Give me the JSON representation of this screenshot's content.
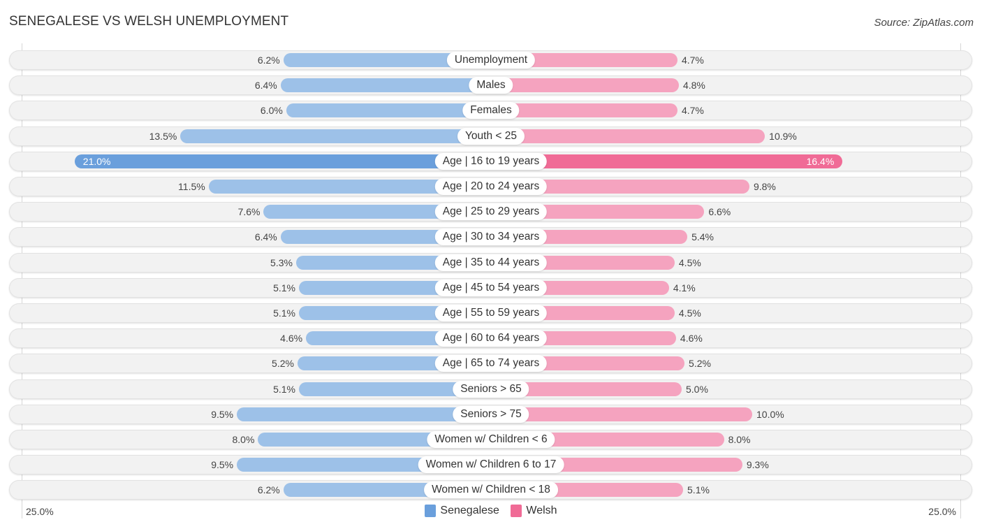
{
  "chart_data": {
    "type": "bar",
    "orientation": "diverging-horizontal",
    "title": "SENEGALESE VS WELSH UNEMPLOYMENT",
    "source": "Source: ZipAtlas.com",
    "categories": [
      "Unemployment",
      "Males",
      "Females",
      "Youth < 25",
      "Age | 16 to 19 years",
      "Age | 20 to 24 years",
      "Age | 25 to 29 years",
      "Age | 30 to 34 years",
      "Age | 35 to 44 years",
      "Age | 45 to 54 years",
      "Age | 55 to 59 years",
      "Age | 60 to 64 years",
      "Age | 65 to 74 years",
      "Seniors > 65",
      "Seniors > 75",
      "Women w/ Children < 6",
      "Women w/ Children 6 to 17",
      "Women w/ Children < 18"
    ],
    "series": [
      {
        "name": "Senegalese",
        "color": "#6a9fdc",
        "light_color": "#9dc1e8",
        "values": [
          6.2,
          6.4,
          6.0,
          13.5,
          21.0,
          11.5,
          7.6,
          6.4,
          5.3,
          5.1,
          5.1,
          4.6,
          5.2,
          5.1,
          9.5,
          8.0,
          9.5,
          6.2
        ]
      },
      {
        "name": "Welsh",
        "color": "#f06b96",
        "light_color": "#f5a3bf",
        "values": [
          4.7,
          4.8,
          4.7,
          10.9,
          16.4,
          9.8,
          6.6,
          5.4,
          4.5,
          4.1,
          4.5,
          4.6,
          5.2,
          5.0,
          10.0,
          8.0,
          9.3,
          5.1
        ]
      }
    ],
    "value_format": "{v}%",
    "axis": {
      "left_label": "25.0%",
      "right_label": "25.0%",
      "max": 25.0
    },
    "legend": {
      "position": "bottom-center",
      "entries": [
        "Senegalese",
        "Welsh"
      ]
    },
    "grid": false
  }
}
